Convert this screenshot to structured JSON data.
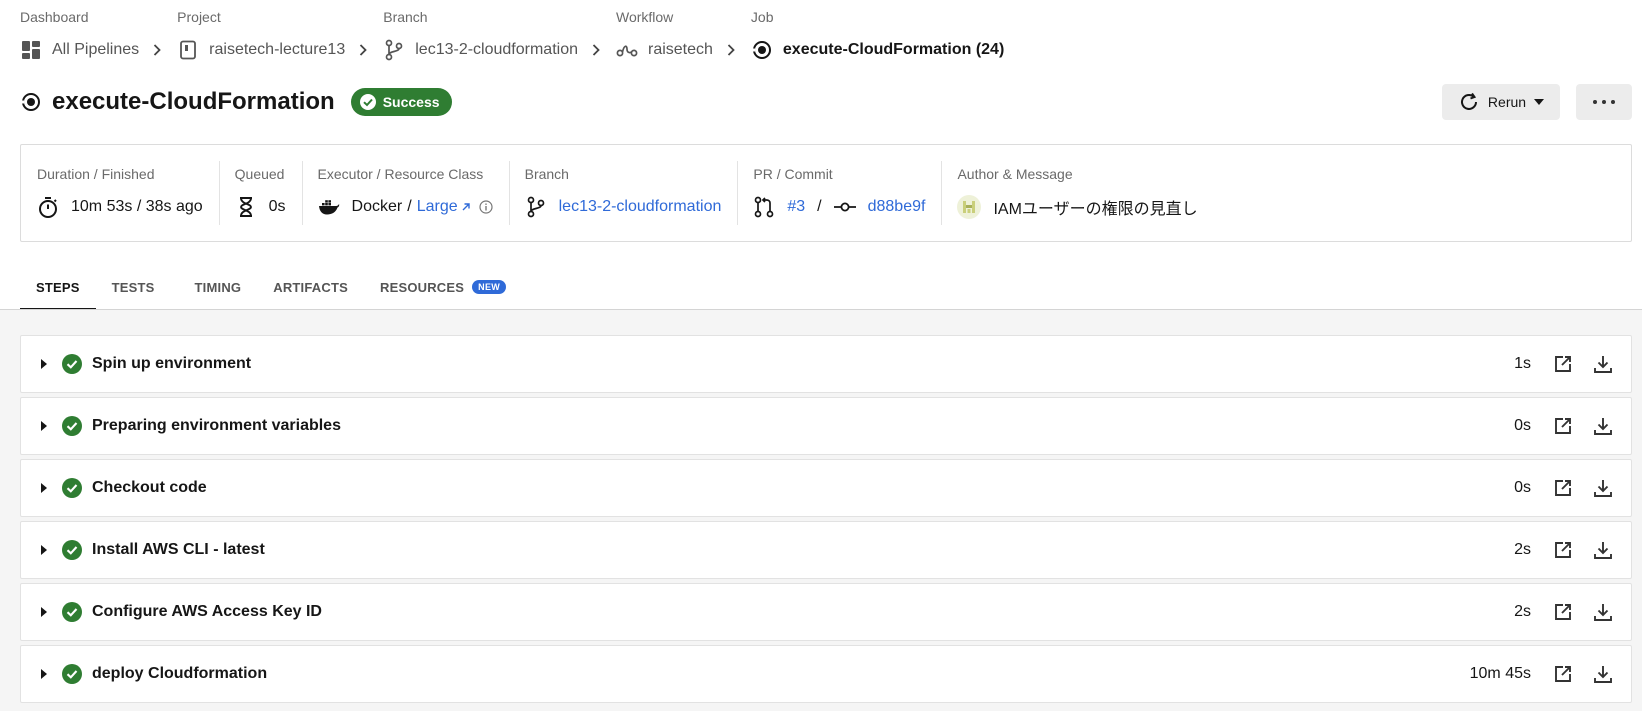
{
  "breadcrumb": [
    {
      "label": "Dashboard",
      "value": "All Pipelines",
      "icon": "dashboard-icon"
    },
    {
      "label": "Project",
      "value": "raisetech-lecture13",
      "icon": "repo-icon"
    },
    {
      "label": "Branch",
      "value": "lec13-2-cloudformation",
      "icon": "branch-icon"
    },
    {
      "label": "Workflow",
      "value": "raisetech",
      "icon": "workflow-icon"
    },
    {
      "label": "Job",
      "value": "execute-CloudFormation (24)",
      "icon": "job-icon"
    }
  ],
  "job": {
    "title": "execute-CloudFormation",
    "status": "Success",
    "status_color": "#2f7d32"
  },
  "actions": {
    "rerun_label": "Rerun"
  },
  "info": {
    "duration": {
      "label": "Duration / Finished",
      "value": "10m 53s / 38s ago"
    },
    "queued": {
      "label": "Queued",
      "value": "0s"
    },
    "executor": {
      "label": "Executor / Resource Class",
      "executor": "Docker",
      "separator": "/",
      "resource_class": "Large"
    },
    "branch": {
      "label": "Branch",
      "value": "lec13-2-cloudformation"
    },
    "pr_commit": {
      "label": "PR / Commit",
      "pr": "#3",
      "separator": "/",
      "commit": "d88be9f"
    },
    "author": {
      "label": "Author & Message",
      "message": "IAMユーザーの権限の見直し"
    }
  },
  "tabs": [
    {
      "label": "STEPS",
      "active": true
    },
    {
      "label": "TESTS"
    },
    {
      "label": "TIMING"
    },
    {
      "label": "ARTIFACTS"
    },
    {
      "label": "RESOURCES",
      "badge": "NEW"
    }
  ],
  "steps": [
    {
      "name": "Spin up environment",
      "duration": "1s"
    },
    {
      "name": "Preparing environment variables",
      "duration": "0s"
    },
    {
      "name": "Checkout code",
      "duration": "0s"
    },
    {
      "name": "Install AWS CLI - latest",
      "duration": "2s"
    },
    {
      "name": "Configure AWS Access Key ID",
      "duration": "2s"
    },
    {
      "name": "deploy Cloudformation",
      "duration": "10m 45s"
    }
  ],
  "colors": {
    "success": "#2f7d32",
    "link": "#2f6ad8",
    "badge_new": "#2f6ad8"
  }
}
